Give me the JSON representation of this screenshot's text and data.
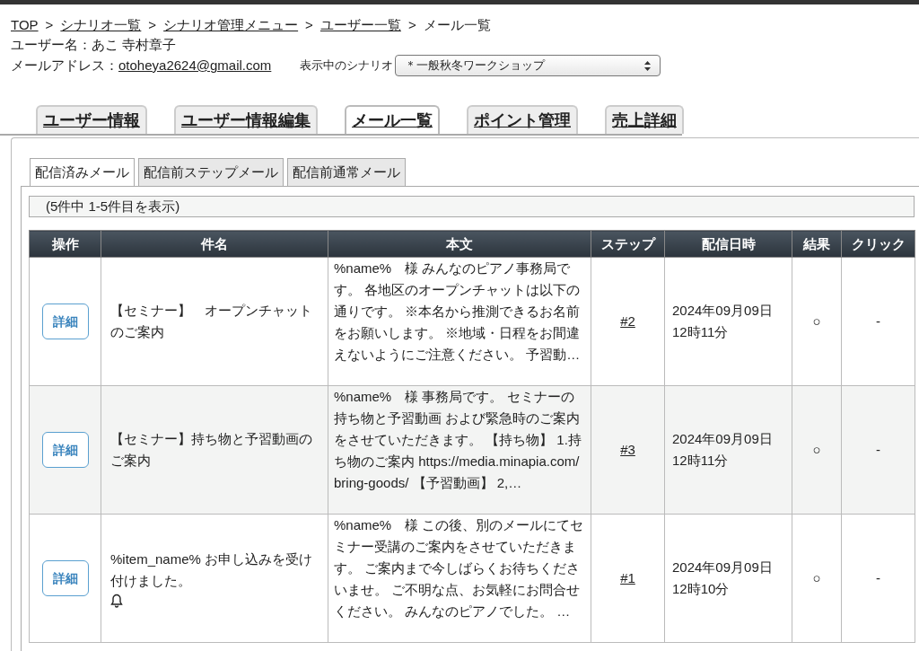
{
  "breadcrumb": [
    {
      "label": "TOP",
      "link": true
    },
    {
      "label": "シナリオ一覧",
      "link": true
    },
    {
      "label": "シナリオ管理メニュー",
      "link": true
    },
    {
      "label": "ユーザー一覧",
      "link": true
    },
    {
      "label": "メール一覧",
      "link": false
    }
  ],
  "separator": ">",
  "user": {
    "name_label": "ユーザー名：",
    "name": "あこ 寺村章子",
    "email_label": "メールアドレス：",
    "email": "otoheya2624@gmail.com",
    "scenario_label": "表示中のシナリオ",
    "scenario_value": "＊一般秋冬ワークショップ"
  },
  "tabs": [
    {
      "label": "ユーザー情報",
      "selected": false
    },
    {
      "label": "ユーザー情報編集",
      "selected": false
    },
    {
      "label": "メール一覧",
      "selected": true
    },
    {
      "label": "ポイント管理",
      "selected": false
    },
    {
      "label": "売上詳細",
      "selected": false
    }
  ],
  "subtabs": [
    {
      "label": "配信済みメール",
      "selected": true
    },
    {
      "label": "配信前ステップメール",
      "selected": false
    },
    {
      "label": "配信前通常メール",
      "selected": false
    }
  ],
  "count_text": "(5件中 1-5件目を表示)",
  "table": {
    "columns": [
      "操作",
      "件名",
      "本文",
      "ステップ",
      "配信日時",
      "結果",
      "クリック"
    ],
    "rows": [
      {
        "action": "詳細",
        "subject": "【セミナー】　オープンチャットのご案内",
        "bell": false,
        "body": "%name%　様 みんなのピアノ事務局です。 各地区のオープンチャットは以下の通りです。 ※本名から推測できるお名前をお願いします。 ※地域・日程をお間違えないようにご注意ください。 予習動…",
        "step": "#2",
        "date": "2024年09月09日",
        "time": "12時11分",
        "result": "○",
        "click": "-"
      },
      {
        "action": "詳細",
        "subject": "【セミナー】持ち物と予習動画のご案内",
        "bell": false,
        "body": "%name%　様 事務局です。 セミナーの持ち物と予習動画 および緊急時のご案内をさせていただきます。 【持ち物】 1.持ち物のご案内 https://media.minapia.com/bring-goods/ 【予習動画】 2,…",
        "step": "#3",
        "date": "2024年09月09日",
        "time": "12時11分",
        "result": "○",
        "click": "-"
      },
      {
        "action": "詳細",
        "subject": "%item_name% お申し込みを受け付けました。",
        "bell": true,
        "body": "%name%　様 この後、別のメールにてセミナー受講のご案内をさせていただきます。 ご案内まで今しばらくお待ちくださいませ。 ご不明な点、お気軽にお問合せください。 みんなのピアノでした。 …",
        "step": "#1",
        "date": "2024年09月09日",
        "time": "12時10分",
        "result": "○",
        "click": "-"
      }
    ]
  }
}
